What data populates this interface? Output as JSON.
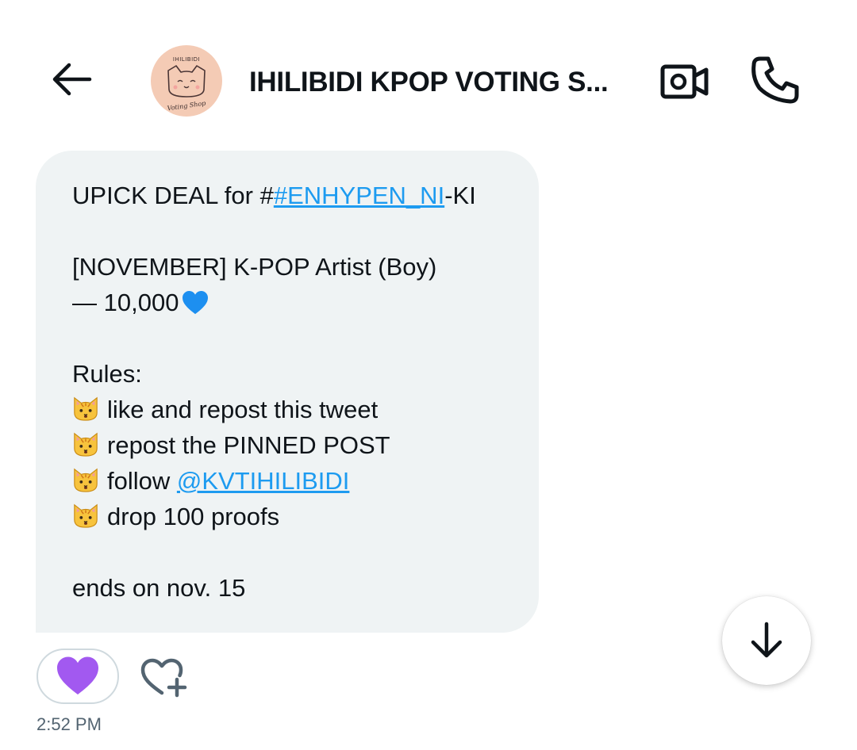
{
  "header": {
    "title": "IHILIBIDI KPOP VOTING S...",
    "avatar_caption_top": "IHILIBIDI",
    "avatar_caption_bottom": "Voting Shop",
    "back_icon": "arrow-left-icon",
    "video_icon": "video-camera-icon",
    "phone_icon": "phone-icon"
  },
  "message": {
    "line1_prefix": "UPICK DEAL for #",
    "line1_link": "#ENHYPEN_NI",
    "line1_suffix": "-KI",
    "line2": "[NOVEMBER] K-POP Artist (Boy)",
    "line3": "— 10,000",
    "line3_emoji": "blue-heart",
    "rules_label": "Rules:",
    "rules": [
      {
        "text": "like and repost this tweet"
      },
      {
        "text": "repost the PINNED POST"
      },
      {
        "text": "follow ",
        "link": "@KVTIHILIBIDI"
      },
      {
        "text": "drop 100 proofs"
      }
    ],
    "rule_emoji": "cat-face",
    "end_line": "ends on nov. 15"
  },
  "reaction": {
    "emoji": "purple-heart"
  },
  "timestamp": "2:52 PM",
  "colors": {
    "bubble": "#eff3f4",
    "link": "#1d9bf0",
    "text": "#0f1419",
    "muted": "#536471",
    "avatar_bg": "#f4cbb5",
    "purple_heart": "#a259f0",
    "blue_heart": "#1d8ff0"
  }
}
